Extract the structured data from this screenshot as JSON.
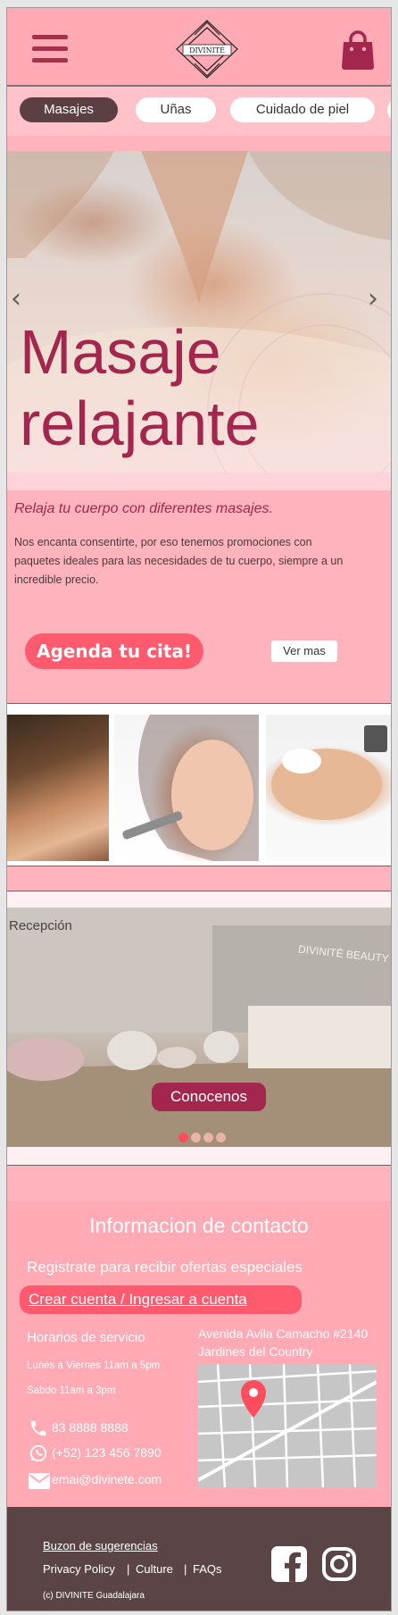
{
  "header": {
    "menu_icon": "hamburger-icon",
    "logo_text": "DIVINITÉ",
    "cart_icon": "shopping-bag-icon"
  },
  "tabs": [
    {
      "label": "Masajes",
      "active": true
    },
    {
      "label": "Uñas",
      "active": false
    },
    {
      "label": "Cuidado de piel",
      "active": false
    }
  ],
  "hero": {
    "title_line1": "Masaje",
    "title_line2": "relajante",
    "prev_icon": "chevron-left-icon",
    "next_icon": "chevron-right-icon",
    "prev_glyph": "‹",
    "next_glyph": "›"
  },
  "intro": {
    "subtitle": "Relaja tu cuerpo con diferentes masajes.",
    "body": "Nos encanta consentirte, por eso tenemos promociones con paquetes ideales para las necesidades de tu cuerpo, siempre a un incredible precio.",
    "cta_label": "Agenda tu cita!",
    "more_label": "Ver mas"
  },
  "reception": {
    "label": "Recepción",
    "sign_text": "DIVINITÉ BEAUTY S",
    "button_label": "Conocenos",
    "dots": 4,
    "active_dot": 0
  },
  "contact": {
    "title": "Informacion de contacto",
    "register_text": "Registrate para recibir ofertas especiales",
    "account_link": "Crear cuenta / Ingresar a cuenta",
    "hours_title": "Horarios de servicio",
    "hours_weekday": "Lunes a Viernes 11am a 5pm",
    "hours_saturday": "Sabdo 11am a 3pm",
    "address_line1": "Avenida Avila Camacho #2140",
    "address_line2": "Jardines del Country",
    "phone": "83 8888 8888",
    "whatsapp": "(+52) 123 456 7890",
    "email": "emai@divinete.com"
  },
  "footer": {
    "suggestions": "Buzon de sugerencias",
    "privacy": "Privacy Policy",
    "culture": "Culture",
    "faqs": "FAQs",
    "separator": "|",
    "copyright": "(c) DIVINITE Guadalajara",
    "facebook_icon": "facebook-icon",
    "instagram_icon": "instagram-icon"
  },
  "colors": {
    "page_pink": "#ffb3bc",
    "accent_wine": "#a3264f",
    "cta_coral": "#ff5a6e",
    "footer_brown": "#5b4446"
  }
}
